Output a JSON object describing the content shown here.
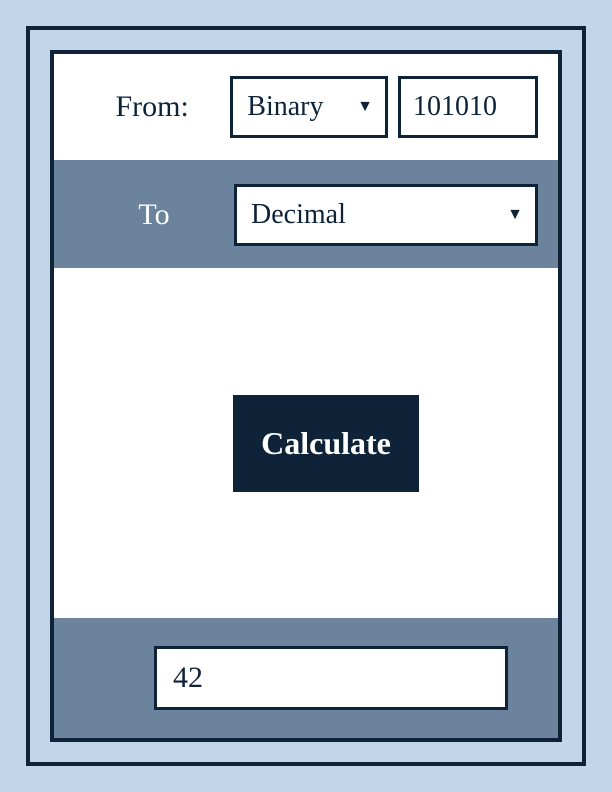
{
  "from": {
    "label": "From:",
    "selected": "Binary",
    "input_value": "101010"
  },
  "to": {
    "label": "To",
    "selected": "Decimal"
  },
  "action": {
    "calculate_label": "Calculate"
  },
  "result": {
    "value": "42"
  }
}
